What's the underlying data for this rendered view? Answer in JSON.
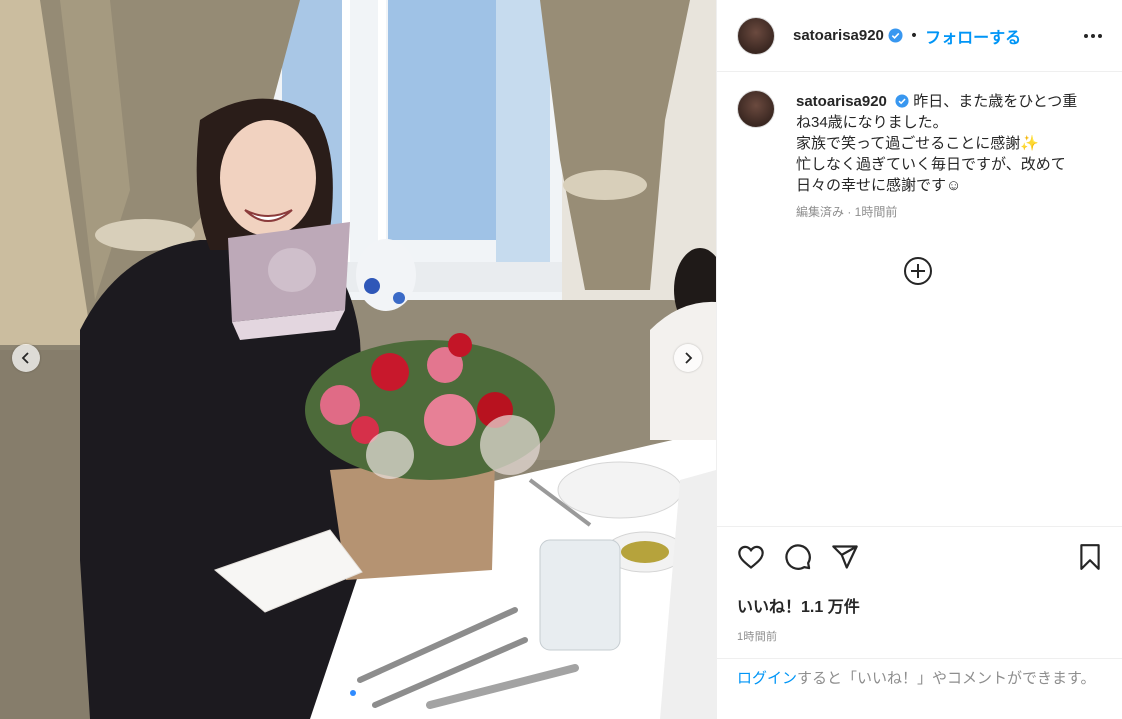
{
  "post": {
    "username": "satoarisa920",
    "follow_label": "フォローする",
    "separator": "•",
    "caption_lines": [
      "昨日、また歳をひとつ重ね34歳になりました。",
      "家族で笑って過ごせることに感謝✨",
      "忙しなく過ぎていく毎日ですが、改めて日々の幸せに感謝です☺"
    ],
    "caption_meta": "編集済み · 1時間前",
    "likes": "いいね！1.1 万件",
    "timestamp": "1時間前",
    "login_link": "ログイン",
    "login_text": "すると「いいね！」やコメントができます。"
  },
  "carousel": {
    "slide_count": 3,
    "active_index": 1
  },
  "colors": {
    "accent": "#0095f6",
    "verified": "#3897f0",
    "muted": "#8e8e8e"
  },
  "icons": [
    "chevron-left-icon",
    "chevron-right-icon",
    "verified-icon",
    "more-icon",
    "add-comment-icon",
    "heart-icon",
    "comment-icon",
    "share-icon",
    "bookmark-icon"
  ]
}
